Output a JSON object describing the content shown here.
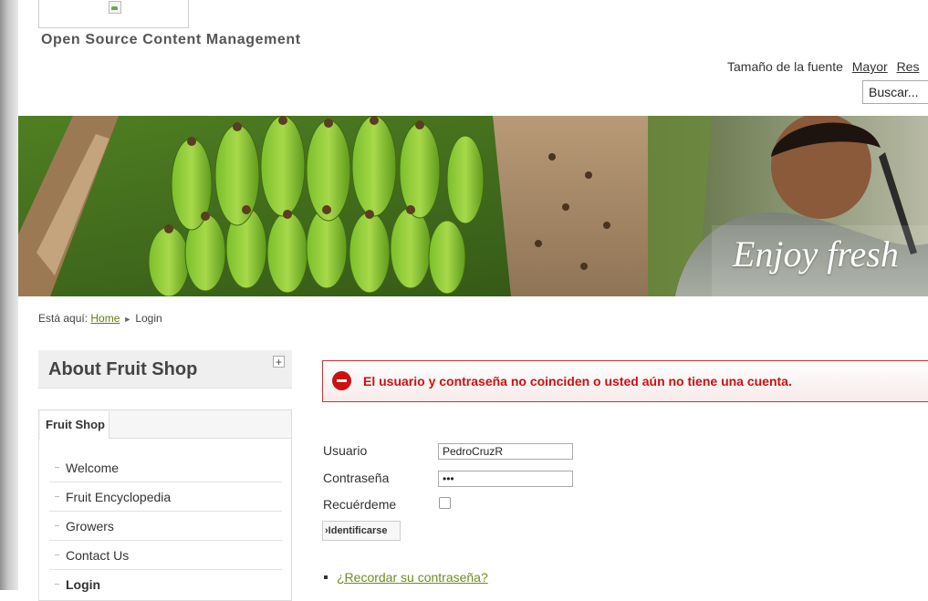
{
  "header": {
    "tagline": "Open Source Content Management",
    "font_size_label": "Tamaño de la fuente",
    "font_size_bigger": "Mayor",
    "font_size_reset": "Res",
    "search_placeholder": "Buscar..."
  },
  "banner": {
    "text": "Enjoy fresh"
  },
  "breadcrumb": {
    "prefix": "Está aquí:",
    "home": "Home",
    "current": "Login"
  },
  "sidebar": {
    "module_title": "About Fruit Shop",
    "toggle_symbol": "+",
    "tab": "Fruit Shop",
    "items": [
      {
        "label": "Welcome"
      },
      {
        "label": "Fruit Encyclopedia"
      },
      {
        "label": "Growers"
      },
      {
        "label": "Contact Us"
      },
      {
        "label": "Login"
      }
    ]
  },
  "login": {
    "error_message": "El usuario y contraseña no coinciden o usted aún no tiene una cuenta.",
    "username_label": "Usuario",
    "username_value": "PedroCruzR",
    "password_label": "Contraseña",
    "password_value": "•••",
    "remember_label": "Recuérdeme",
    "remember_checked": false,
    "submit_label": "›Identificarse",
    "forgot_password_link": "¿Recordar su contraseña?"
  }
}
